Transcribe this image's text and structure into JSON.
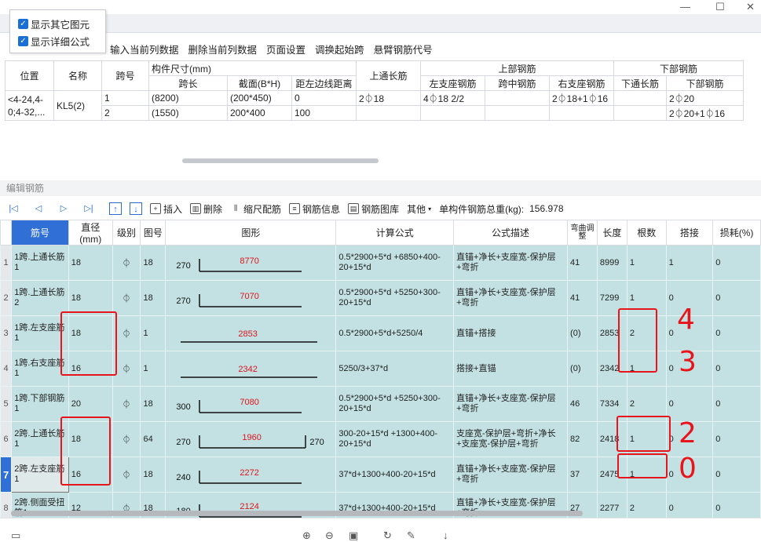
{
  "window": {
    "minimize": "—",
    "maximize": "☐",
    "close": "✕"
  },
  "popup": {
    "items": [
      "显示其它图元",
      "显示详细公式"
    ]
  },
  "toolbar1": [
    "输入当前列数据",
    "删除当前列数据",
    "页面设置",
    "调换起始跨",
    "悬臂钢筋代号"
  ],
  "top_table": {
    "h1": [
      "位置",
      "名称",
      "跨号",
      "构件尺寸(mm)",
      "上通长筋",
      "上部钢筋",
      "下部钢筋"
    ],
    "h2": [
      "跨长",
      "截面(B*H)",
      "距左边线距离",
      "左支座钢筋",
      "跨中钢筋",
      "右支座钢筋",
      "下通长筋",
      "下部钢筋"
    ],
    "position": [
      "<4-24,4-",
      "0;4-32,..."
    ],
    "name": "KL5(2)",
    "rows": [
      [
        "1",
        "(8200)",
        "(200*450)",
        "0",
        "2⏀18",
        "4⏀18 2/2",
        "",
        "2⏀18+1⏀16",
        "",
        "2⏀20"
      ],
      [
        "2",
        "(1550)",
        "200*400",
        "100",
        "",
        "",
        "",
        "",
        "",
        "2⏀20+1⏀16"
      ]
    ]
  },
  "section_title": "编辑钢筋",
  "toolbar2": {
    "insert": "插入",
    "delete": "删除",
    "scale": "缩尺配筋",
    "info": "钢筋信息",
    "library": "钢筋图库",
    "other": "其他",
    "total_label": "单构件钢筋总重(kg):",
    "total_value": "156.978"
  },
  "grid_headers": [
    "筋号",
    "直径(mm)",
    "级别",
    "图号",
    "图形",
    "计算公式",
    "公式描述",
    "弯曲调整",
    "长度",
    "根数",
    "搭接",
    "损耗(%)"
  ],
  "rows": [
    {
      "n": "1",
      "name": "1跨.上通长筋1",
      "dia": "18",
      "grade": "⏀",
      "fig": "18",
      "l": "270",
      "mid": "8770",
      "r": "",
      "formula": "0.5*2900+5*d +6850+400-20+15*d",
      "desc": "直锚+净长+支座宽-保护层+弯折",
      "bend": "41",
      "len": "8999",
      "cnt": "1",
      "lap": "1",
      "loss": "0"
    },
    {
      "n": "2",
      "name": "1跨.上通长筋2",
      "dia": "18",
      "grade": "⏀",
      "fig": "18",
      "l": "270",
      "mid": "7070",
      "r": "",
      "formula": "0.5*2900+5*d +5250+300-20+15*d",
      "desc": "直锚+净长+支座宽-保护层+弯折",
      "bend": "41",
      "len": "7299",
      "cnt": "1",
      "lap": "0",
      "loss": "0"
    },
    {
      "n": "3",
      "name": "1跨.左支座筋1",
      "dia": "18",
      "grade": "⏀",
      "fig": "1",
      "l": "",
      "mid": "2853",
      "r": "",
      "formula": "0.5*2900+5*d+5250/4",
      "desc": "直锚+搭接",
      "bend": "(0)",
      "len": "2853",
      "cnt": "2",
      "lap": "0",
      "loss": "0"
    },
    {
      "n": "4",
      "name": "1跨.右支座筋1",
      "dia": "16",
      "grade": "⏀",
      "fig": "1",
      "l": "",
      "mid": "2342",
      "r": "",
      "formula": "5250/3+37*d",
      "desc": "搭接+直锚",
      "bend": "(0)",
      "len": "2342",
      "cnt": "1",
      "lap": "0",
      "loss": "0"
    },
    {
      "n": "5",
      "name": "1跨.下部钢筋1",
      "dia": "20",
      "grade": "⏀",
      "fig": "18",
      "l": "300",
      "mid": "7080",
      "r": "",
      "formula": "0.5*2900+5*d +5250+300-20+15*d",
      "desc": "直锚+净长+支座宽-保护层+弯折",
      "bend": "46",
      "len": "7334",
      "cnt": "2",
      "lap": "0",
      "loss": "0"
    },
    {
      "n": "6",
      "name": "2跨.上通长筋1",
      "dia": "18",
      "grade": "⏀",
      "fig": "64",
      "l": "270",
      "mid": "1960",
      "r": "270",
      "formula": "300-20+15*d +1300+400-20+15*d",
      "desc": "支座宽-保护层+弯折+净长+支座宽-保护层+弯折",
      "bend": "82",
      "len": "2418",
      "cnt": "1",
      "lap": "0",
      "loss": "0"
    },
    {
      "n": "7",
      "name": "2跨.左支座筋1",
      "dia": "16",
      "grade": "⏀",
      "fig": "18",
      "l": "240",
      "mid": "2272",
      "r": "",
      "formula": "37*d+1300+400-20+15*d",
      "desc": "直锚+净长+支座宽-保护层+弯折",
      "bend": "37",
      "len": "2475",
      "cnt": "1",
      "lap": "0",
      "loss": "0"
    },
    {
      "n": "8",
      "name": "2跨.侧面受扭筋1",
      "dia": "12",
      "grade": "⏀",
      "fig": "18",
      "l": "180",
      "mid": "2124",
      "r": "",
      "formula": "37*d+1300+400-20+15*d",
      "desc": "直锚+净长+支座宽-保护层+弯折",
      "bend": "27",
      "len": "2277",
      "cnt": "2",
      "lap": "0",
      "loss": "0"
    }
  ],
  "annotations": [
    "4",
    "3",
    "2",
    "0"
  ]
}
